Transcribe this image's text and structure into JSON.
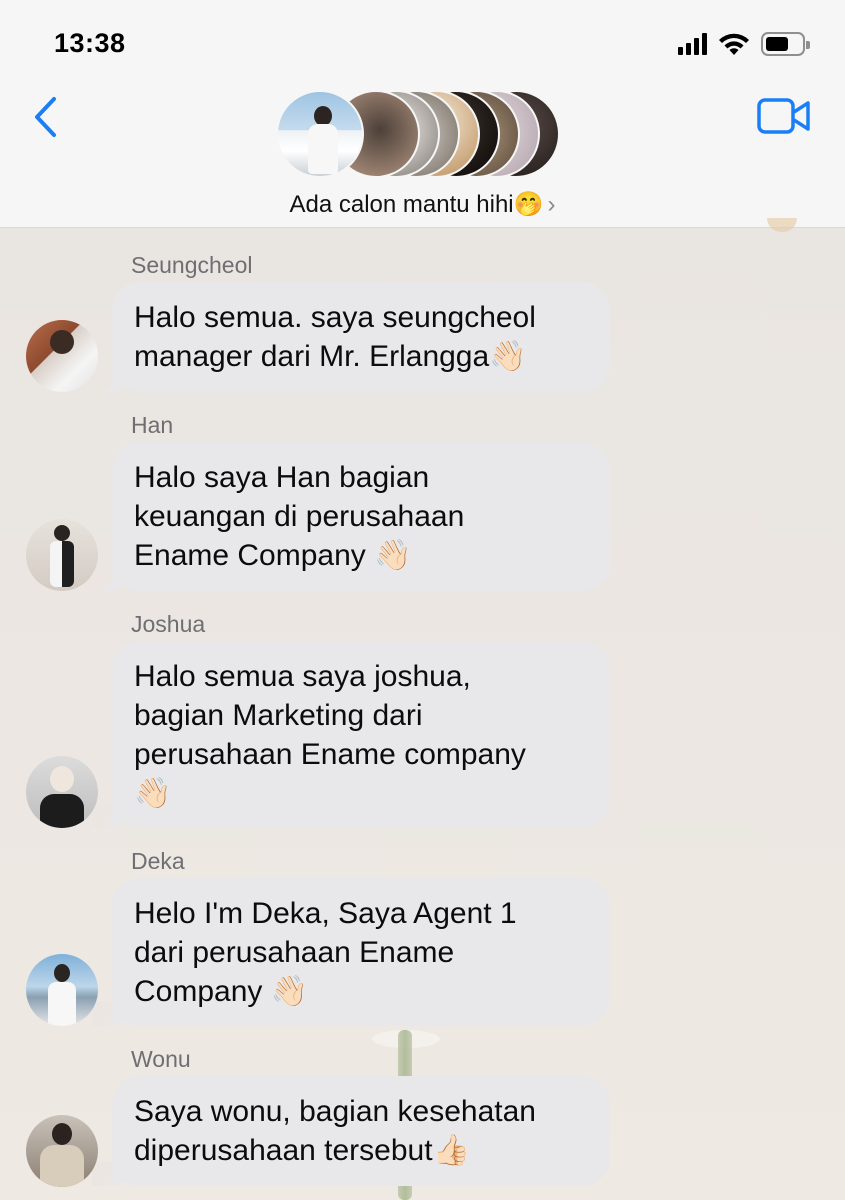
{
  "status_bar": {
    "time": "13:38"
  },
  "header": {
    "back_icon": "chevron-left-icon",
    "video_icon": "video-camera-icon",
    "group_name": "Ada calon mantu hihi🤭",
    "chevron": "›",
    "accent": "#1a7ef5"
  },
  "messages": [
    {
      "sender": "Seungcheol",
      "text": "Halo semua. saya seungcheol\nmanager dari Mr. Erlangga👋🏻"
    },
    {
      "sender": "Han",
      "text": "Halo saya Han bagian\nkeuangan di perusahaan\nEname Company 👋🏻"
    },
    {
      "sender": "Joshua",
      "text": "Halo semua saya joshua,\nbagian Marketing dari\nperusahaan Ename company\n👋🏻"
    },
    {
      "sender": "Deka",
      "text": "Helo I'm Deka, Saya Agent 1\ndari perusahaan Ename\nCompany 👋🏻"
    },
    {
      "sender": "Wonu",
      "text": "Saya wonu, bagian kesehatan\ndiperusahaan tersebut👍🏻"
    }
  ]
}
